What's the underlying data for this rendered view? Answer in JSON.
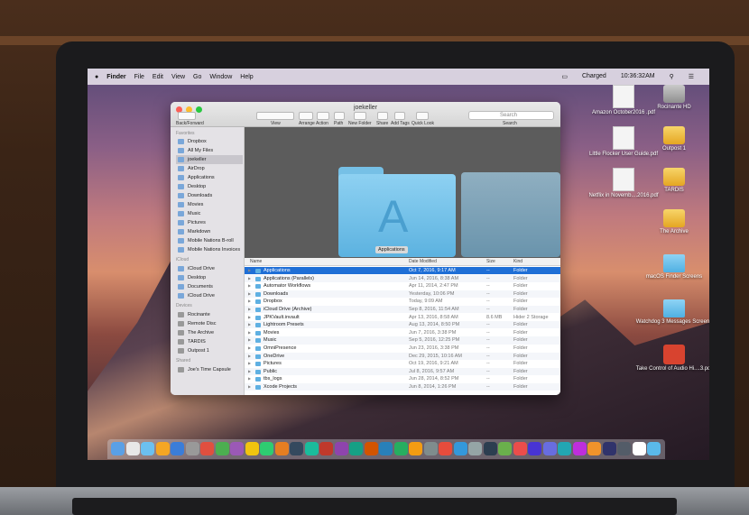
{
  "menubar": {
    "items": [
      "Finder",
      "File",
      "Edit",
      "View",
      "Go",
      "Window",
      "Help"
    ],
    "status": "Charged",
    "clock": "10:36:32AM"
  },
  "window": {
    "title": "joekeller",
    "back_forward": "Back/Forward",
    "toolbar": [
      "View",
      "Arrange",
      "Action",
      "Path",
      "New Folder",
      "Share",
      "Add Tags",
      "Quick Look"
    ],
    "search_placeholder": "Search",
    "search_label": "Search"
  },
  "sidebar": {
    "favorites_head": "Favorites",
    "favorites": [
      "Dropbox",
      "All My Files",
      "joekeller",
      "AirDrop",
      "Applications",
      "Desktop",
      "Downloads",
      "Movies",
      "Music",
      "Pictures",
      "Markdown",
      "Mobile Nations B-roll",
      "Mobile Nations Invoices"
    ],
    "icloud_head": "iCloud",
    "icloud": [
      "iCloud Drive",
      "Desktop",
      "Documents",
      "iCloud Drive"
    ],
    "devices_head": "Devices",
    "devices": [
      "Rocinante",
      "Remote Disc",
      "The Archive",
      "TARDIS",
      "Outpost 1"
    ],
    "shared_head": "Shared",
    "shared": [
      "Joe's Time Capsule"
    ]
  },
  "preview": {
    "label": "Applications"
  },
  "list": {
    "headers": {
      "name": "Name",
      "date": "Date Modified",
      "size": "Size",
      "kind": "Kind"
    },
    "rows": [
      {
        "name": "Applications",
        "date": "Oct 7, 2016, 9:17 AM",
        "size": "--",
        "kind": "Folder"
      },
      {
        "name": "Applications (Parallels)",
        "date": "Jun 14, 2016, 8:38 AM",
        "size": "--",
        "kind": "Folder"
      },
      {
        "name": "Automator Workflows",
        "date": "Apr 11, 2014, 2:47 PM",
        "size": "--",
        "kind": "Folder"
      },
      {
        "name": "Downloads",
        "date": "Yesterday, 10:06 PM",
        "size": "--",
        "kind": "Folder"
      },
      {
        "name": "Dropbox",
        "date": "Today, 9:09 AM",
        "size": "--",
        "kind": "Folder"
      },
      {
        "name": "iCloud Drive (Archive)",
        "date": "Sep 8, 2016, 11:54 AM",
        "size": "--",
        "kind": "Folder"
      },
      {
        "name": "JPKVault.invault",
        "date": "Apr 13, 2016, 8:58 AM",
        "size": "8.6 MB",
        "kind": "Hider 2 Storage"
      },
      {
        "name": "Lightroom Presets",
        "date": "Aug 13, 2014, 8:50 PM",
        "size": "--",
        "kind": "Folder"
      },
      {
        "name": "Movies",
        "date": "Jun 7, 2016, 3:38 PM",
        "size": "--",
        "kind": "Folder"
      },
      {
        "name": "Music",
        "date": "Sep 5, 2016, 12:25 PM",
        "size": "--",
        "kind": "Folder"
      },
      {
        "name": "OmniPresence",
        "date": "Jun 23, 2016, 3:38 PM",
        "size": "--",
        "kind": "Folder"
      },
      {
        "name": "OneDrive",
        "date": "Dec 29, 2015, 10:16 AM",
        "size": "--",
        "kind": "Folder"
      },
      {
        "name": "Pictures",
        "date": "Oct 19, 2016, 9:21 AM",
        "size": "--",
        "kind": "Folder"
      },
      {
        "name": "Public",
        "date": "Jul 8, 2016, 9:57 AM",
        "size": "--",
        "kind": "Folder"
      },
      {
        "name": "tbs_logs",
        "date": "Jun 28, 2014, 8:52 PM",
        "size": "--",
        "kind": "Folder"
      },
      {
        "name": "Xcode Projects",
        "date": "Jun 8, 2014, 1:26 PM",
        "size": "--",
        "kind": "Folder"
      }
    ]
  },
  "desktop": [
    {
      "label": "Amazon October2016 .pdf",
      "icon": "pdf-document-icon"
    },
    {
      "label": "Rocinante HD",
      "icon": "hard-drive-icon"
    },
    {
      "label": "Little Flocker User Guide.pdf",
      "icon": "pdf-document-icon"
    },
    {
      "label": "Outpost 1",
      "icon": "external-drive-icon"
    },
    {
      "label": "Netflix in Novemb....2016.pdf",
      "icon": "pdf-document-icon"
    },
    {
      "label": "TARDIS",
      "icon": "external-drive-icon"
    },
    {
      "label": "The Archive",
      "icon": "external-drive-icon"
    },
    {
      "label": "macOS Finder Screens",
      "icon": "folder-icon"
    },
    {
      "label": "Watchdog 3 Messages Screens",
      "icon": "folder-icon"
    },
    {
      "label": "Take Control of Audio Hi....3.pdf",
      "icon": "pdf-document-icon"
    }
  ]
}
